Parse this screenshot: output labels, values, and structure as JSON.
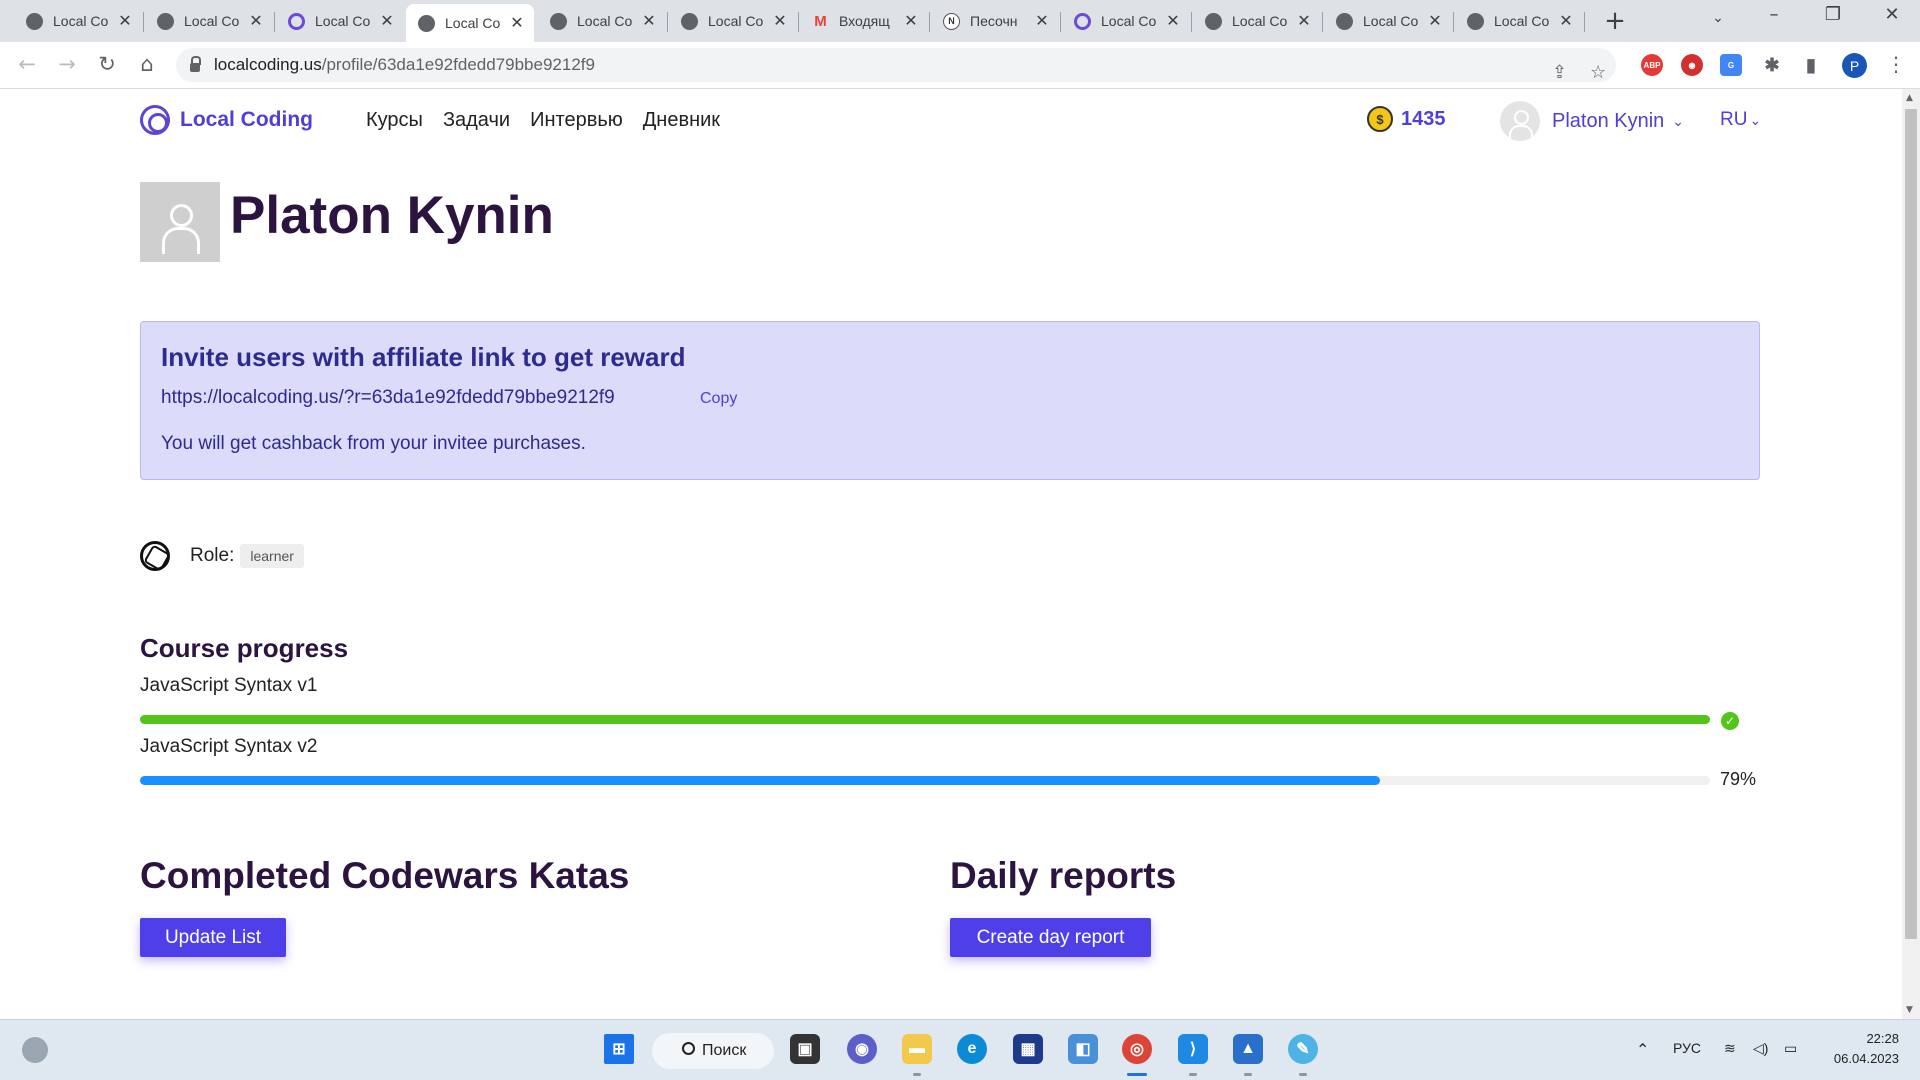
{
  "browser": {
    "tabs": [
      {
        "title": "Local Co",
        "icon": "globe-icon",
        "active": false
      },
      {
        "title": "Local Co",
        "icon": "globe-icon",
        "active": false
      },
      {
        "title": "Local Co",
        "icon": "localcoding-icon",
        "active": false
      },
      {
        "title": "Local Co",
        "icon": "globe-icon",
        "active": true
      },
      {
        "title": "Local Co",
        "icon": "globe-icon",
        "active": false
      },
      {
        "title": "Local Co",
        "icon": "globe-icon",
        "active": false
      },
      {
        "title": "Входящ",
        "icon": "gmail-icon",
        "active": false
      },
      {
        "title": "Песочн",
        "icon": "notion-icon",
        "active": false
      },
      {
        "title": "Local Co",
        "icon": "localcoding-icon",
        "active": false
      },
      {
        "title": "Local Co",
        "icon": "globe-icon",
        "active": false
      },
      {
        "title": "Local Co",
        "icon": "globe-icon",
        "active": false
      },
      {
        "title": "Local Co",
        "icon": "globe-icon",
        "active": false
      }
    ],
    "url_host": "localcoding.us",
    "url_path": "/profile/63da1e92fdedd79bbe9212f9",
    "profile_initial": "P",
    "extensions": [
      "adblock-icon",
      "extension-red-icon",
      "translate-icon",
      "puzzle-icon",
      "sidepanel-icon"
    ]
  },
  "site": {
    "logo_text": "Local Coding",
    "nav": [
      "Курсы",
      "Задачи",
      "Интервью",
      "Дневник"
    ],
    "coins": "1435",
    "user_name": "Platon Kynin",
    "language": "RU"
  },
  "profile": {
    "name": "Platon Kynin",
    "invite": {
      "title": "Invite users with affiliate link to get reward",
      "link": "https://localcoding.us/?r=63da1e92fdedd79bbe9212f9",
      "copy_label": "Copy",
      "note": "You will get cashback from your invitee purchases."
    },
    "role_label": "Role:",
    "role_value": "learner",
    "course_progress_title": "Course progress",
    "courses": [
      {
        "name": "JavaScript Syntax v1",
        "progress": 100,
        "completed": true,
        "color": "#52c41a"
      },
      {
        "name": "JavaScript Syntax v2",
        "progress": 79,
        "progress_label": "79%",
        "completed": false,
        "color": "#1890ff"
      }
    ],
    "katas_title": "Completed Codewars Katas",
    "update_list_label": "Update List",
    "reports_title": "Daily reports",
    "create_report_label": "Create day report"
  },
  "taskbar": {
    "search_label": "Поиск",
    "language": "РУС",
    "time": "22:28",
    "date": "06.04.2023"
  },
  "colors": {
    "brand": "#4f3fd6",
    "heading": "#2b1540",
    "invite_bg": "#dcdcfa",
    "button": "#4f3fe8"
  }
}
